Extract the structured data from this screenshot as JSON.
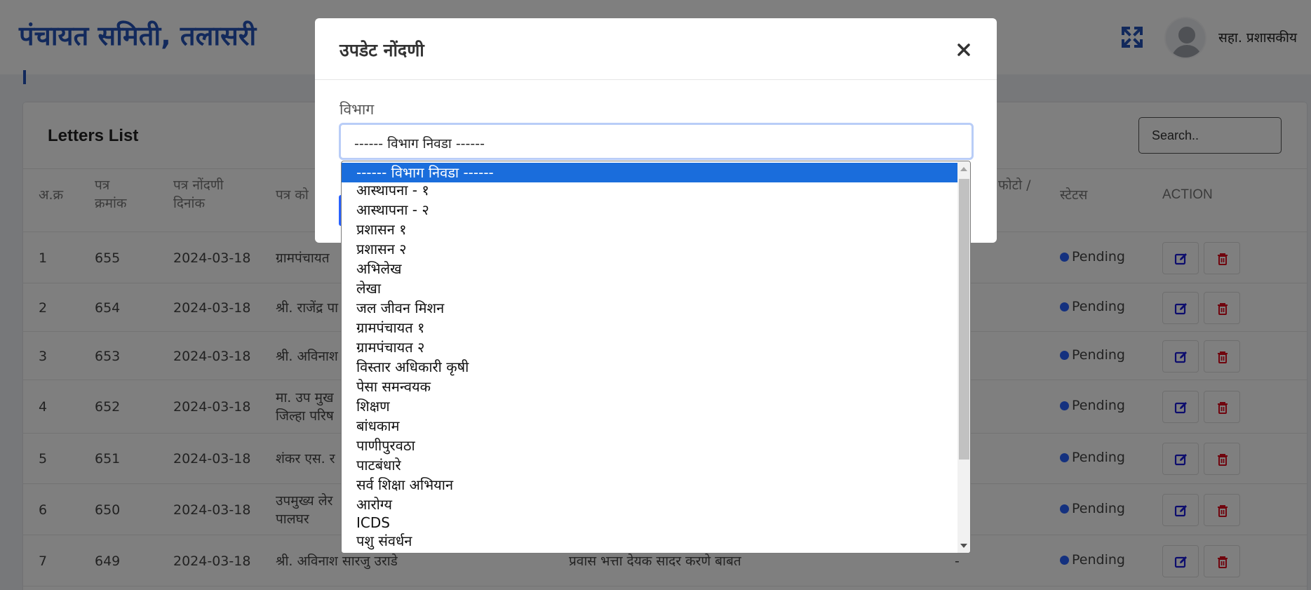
{
  "header": {
    "brand": "पंचायत समिती, तलासरी",
    "user_role": "सहा. प्रशासकीय"
  },
  "card": {
    "title": "Letters List",
    "search_placeholder": "Search.."
  },
  "table": {
    "headers": {
      "sr": "अ.क्र",
      "letter_no": "पत्र क्रमांक",
      "reg_date": "पत्र नोंदणी दिनांक",
      "from": "पत्र को",
      "photo": "फोटो /",
      "status": "स्टेटस",
      "action": "ACTION"
    },
    "rows": [
      {
        "sr": "1",
        "no": "655",
        "date": "2024-03-18",
        "from": "ग्रामपंचायत",
        "status": "Pending"
      },
      {
        "sr": "2",
        "no": "654",
        "date": "2024-03-18",
        "from": "श्री. राजेंद्र पा",
        "status": "Pending"
      },
      {
        "sr": "3",
        "no": "653",
        "date": "2024-03-18",
        "from": "श्री. अविनाश",
        "status": "Pending"
      },
      {
        "sr": "4",
        "no": "652",
        "date": "2024-03-18",
        "from": "मा. उप मुख\nजिल्हा परिष",
        "status": "Pending"
      },
      {
        "sr": "5",
        "no": "651",
        "date": "2024-03-18",
        "from": "शंकर एस. र",
        "status": "Pending"
      },
      {
        "sr": "6",
        "no": "650",
        "date": "2024-03-18",
        "from": "उपमुख्य लेर\nपालघर",
        "status": "Pending"
      },
      {
        "sr": "7",
        "no": "649",
        "date": "2024-03-18",
        "from": "श्री. अविनाश सारजु उराडे",
        "subject": "प्रवास भत्ता देयक सादर करणे बाबत",
        "photo": "-",
        "status": "Pending"
      }
    ]
  },
  "modal": {
    "title": "उपडेट नोंदणी",
    "field_label": "विभाग",
    "selected_value": "------ विभाग निवडा ------"
  },
  "dropdown": {
    "options": [
      "------ विभाग निवडा ------",
      "आस्थापना - १",
      "आस्थापना - २",
      "प्रशासन १",
      "प्रशासन २",
      "अभिलेख",
      "लेखा",
      "जल जीवन मिशन",
      "ग्रामपंचायत १",
      "ग्रामपंचायत २",
      "विस्तार अधिकारी कृषी",
      "पेसा समन्वयक",
      "शिक्षण",
      "बांधकाम",
      "पाणीपुरवठा",
      "पाटबंधारे",
      "सर्व शिक्षा अभियान",
      "आरोग्य",
      "ICDS",
      "पशु संवर्धन"
    ]
  },
  "colors": {
    "brand": "#2553b8",
    "selected_option": "#1a6ddc",
    "status_dot": "#2962ff",
    "edit_icon": "#1a1adb",
    "delete_icon": "#e00b1c"
  }
}
